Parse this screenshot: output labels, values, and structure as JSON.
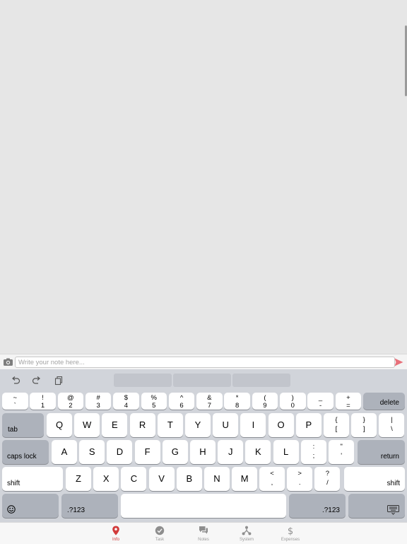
{
  "compose": {
    "placeholder": "Write your note here..."
  },
  "keyboard": {
    "number_row": [
      {
        "top": "~",
        "bottom": "`"
      },
      {
        "top": "!",
        "bottom": "1"
      },
      {
        "top": "@",
        "bottom": "2"
      },
      {
        "top": "#",
        "bottom": "3"
      },
      {
        "top": "$",
        "bottom": "4"
      },
      {
        "top": "%",
        "bottom": "5"
      },
      {
        "top": "^",
        "bottom": "6"
      },
      {
        "top": "&",
        "bottom": "7"
      },
      {
        "top": "*",
        "bottom": "8"
      },
      {
        "top": "(",
        "bottom": "9"
      },
      {
        "top": ")",
        "bottom": "0"
      },
      {
        "top": "_",
        "bottom": "-"
      },
      {
        "top": "+",
        "bottom": "="
      }
    ],
    "delete_label": "delete",
    "tab_label": "tab",
    "row_qwerty": [
      "Q",
      "W",
      "E",
      "R",
      "T",
      "Y",
      "U",
      "I",
      "O",
      "P"
    ],
    "row_qwerty_symbols": [
      {
        "top": "{",
        "bottom": "["
      },
      {
        "top": "}",
        "bottom": "]"
      },
      {
        "top": "|",
        "bottom": "\\"
      }
    ],
    "caps_label": "caps lock",
    "row_home": [
      "A",
      "S",
      "D",
      "F",
      "G",
      "H",
      "J",
      "K",
      "L"
    ],
    "row_home_symbols": [
      {
        "top": ":",
        "bottom": ";"
      },
      {
        "top": "\"",
        "bottom": "'"
      }
    ],
    "return_label": "return",
    "shift_label": "shift",
    "row_bottom": [
      "Z",
      "X",
      "C",
      "V",
      "B",
      "N",
      "M"
    ],
    "row_bottom_symbols": [
      {
        "top": "<",
        "bottom": ","
      },
      {
        "top": ">",
        "bottom": "."
      },
      {
        "top": "?",
        "bottom": "/"
      }
    ],
    "numbers_label": ".?123",
    "emoji_icon": "emoji-icon",
    "hide_keyboard_icon": "keyboard-hide-icon"
  },
  "tabs": [
    {
      "label": "Info",
      "icon": "location-pin-icon",
      "active": true
    },
    {
      "label": "Task",
      "icon": "check-circle-icon",
      "active": false
    },
    {
      "label": "Notes",
      "icon": "chat-bubbles-icon",
      "active": false
    },
    {
      "label": "System",
      "icon": "network-icon",
      "active": false
    },
    {
      "label": "Expenses",
      "icon": "dollar-icon",
      "active": false
    }
  ],
  "colors": {
    "accent": "#d23a3a",
    "send": "#e8707a"
  }
}
